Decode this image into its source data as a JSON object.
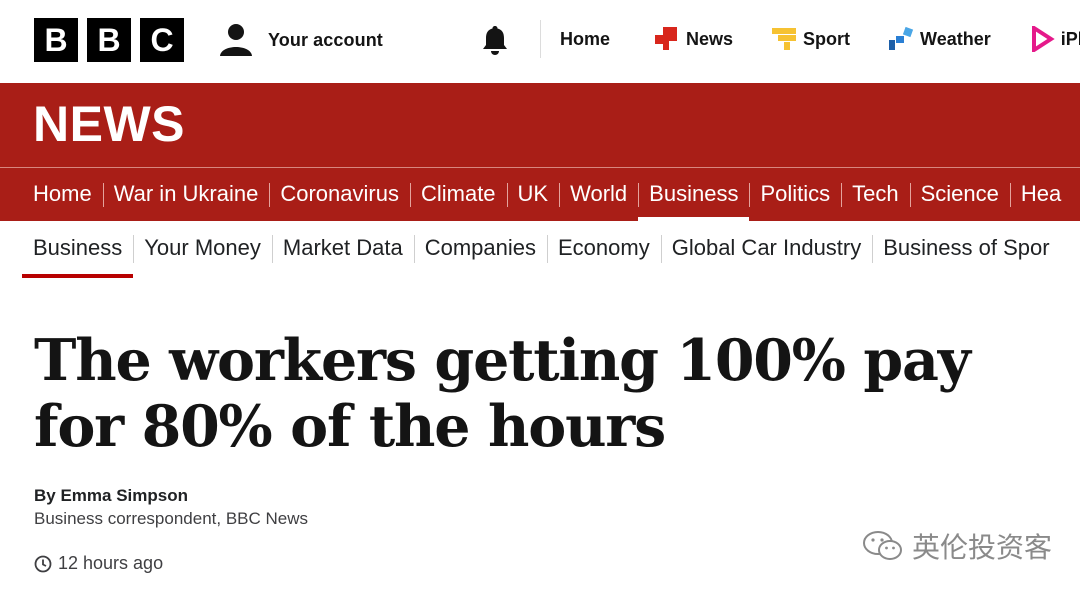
{
  "masthead": {
    "logo_letters": [
      "B",
      "B",
      "C"
    ],
    "account_label": "Your account",
    "nav": [
      {
        "label": "Home",
        "icon": "none"
      },
      {
        "label": "News",
        "icon": "news-icon",
        "color": "#d8261c"
      },
      {
        "label": "Sport",
        "icon": "sport-icon",
        "color": "#f6c232"
      },
      {
        "label": "Weather",
        "icon": "weather-icon",
        "color": "#2a7fd4"
      },
      {
        "label": "iPla",
        "icon": "iplayer-icon",
        "color": "#e5198a"
      }
    ]
  },
  "banner": {
    "title": "NEWS",
    "color": "#a91e17"
  },
  "section_nav": [
    "Home",
    "War in Ukraine",
    "Coronavirus",
    "Climate",
    "UK",
    "World",
    "Business",
    "Politics",
    "Tech",
    "Science",
    "Hea"
  ],
  "section_nav_active": "Business",
  "sub_nav": [
    "Business",
    "Your Money",
    "Market Data",
    "Companies",
    "Economy",
    "Global Car Industry",
    "Business of Spor"
  ],
  "sub_nav_active": "Business",
  "article": {
    "headline": "The workers getting 100% pay for 80% of the hours",
    "author": "By Emma Simpson",
    "role": "Business correspondent, BBC News",
    "timestamp": "12 hours ago"
  },
  "watermark": "英伦投资客"
}
